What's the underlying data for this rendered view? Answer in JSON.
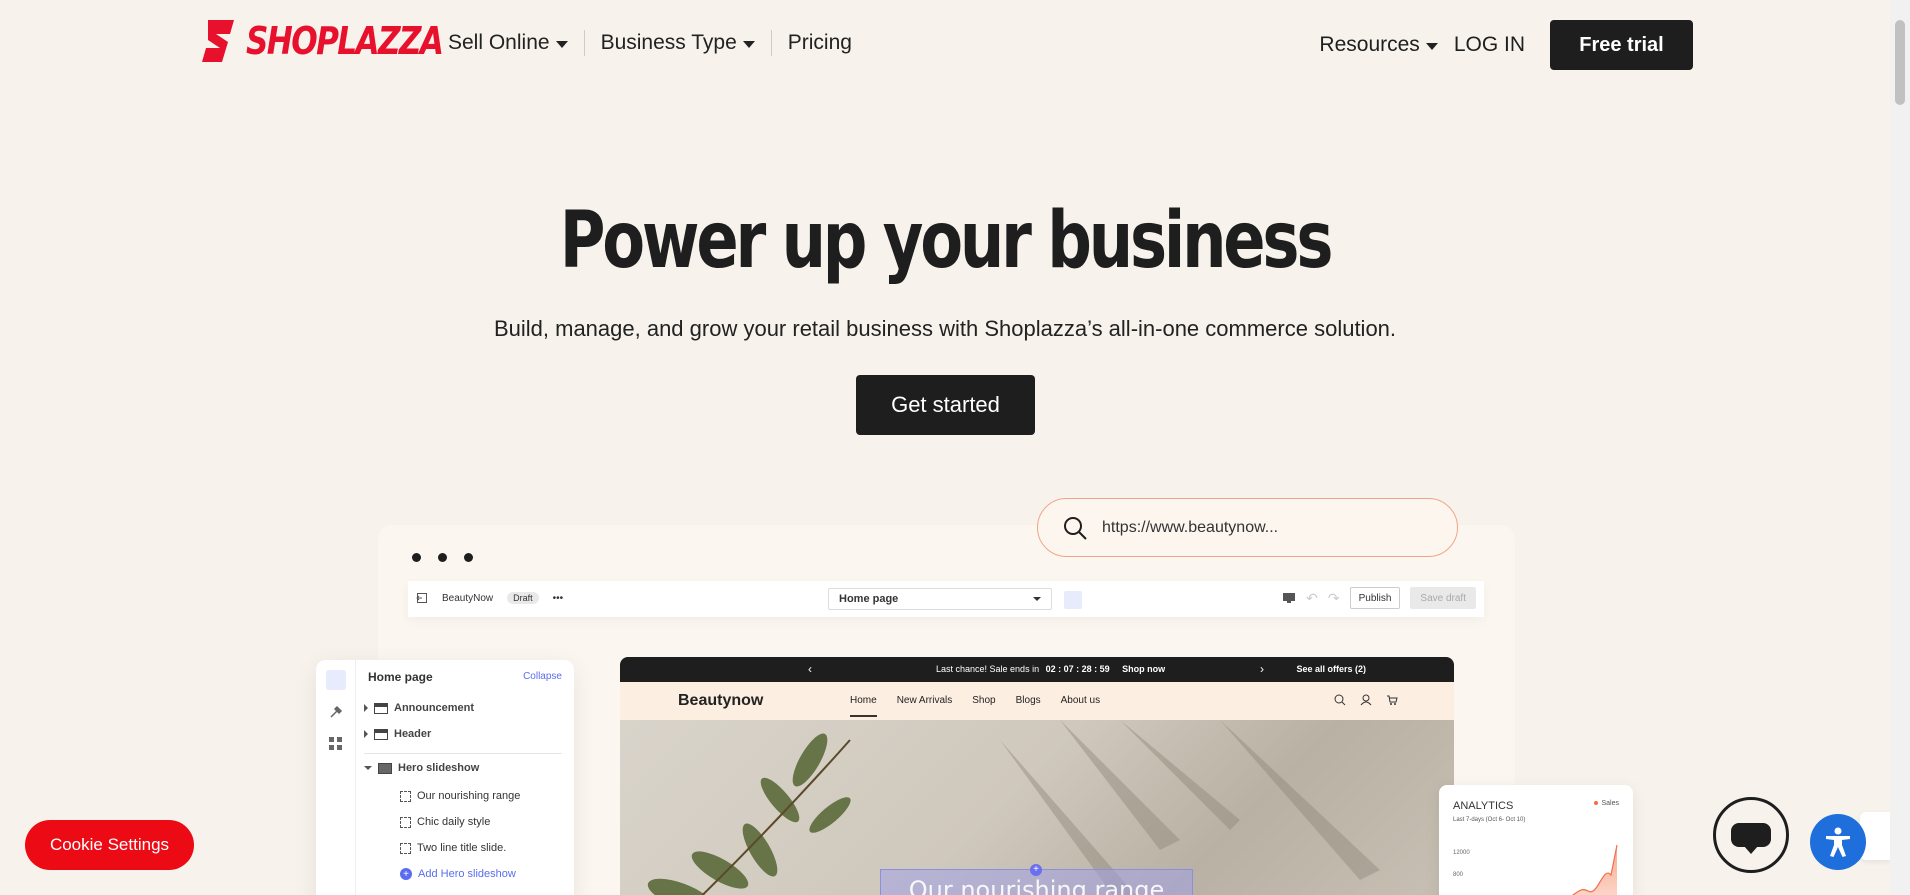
{
  "nav": {
    "logo_text": "SHOPLAZZA",
    "menu": [
      {
        "label": "Sell Online",
        "dropdown": true
      },
      {
        "label": "Business Type",
        "dropdown": true
      },
      {
        "label": "Pricing",
        "dropdown": false
      }
    ],
    "resources": "Resources",
    "login": "LOG IN",
    "trial": "Free trial"
  },
  "hero": {
    "title": "Power up your business",
    "subtitle": "Build, manage, and grow your retail business with Shoplazza’s all-in-one commerce solution.",
    "cta": "Get started"
  },
  "mockup": {
    "search_text": "https://www.beautynow...",
    "editor": {
      "store_name": "BeautyNow",
      "status": "Draft",
      "page_select": "Home page",
      "publish": "Publish",
      "save_draft": "Save draft"
    },
    "panel": {
      "title": "Home page",
      "collapse": "Collapse",
      "sections": [
        "Announcement",
        "Header",
        "Hero slideshow"
      ],
      "slides": [
        "Our nourishing range",
        "Chic daily style",
        "Two line title slide."
      ],
      "add": "Add Hero slideshow"
    },
    "store": {
      "announcement": "Last chance! Sale ends in",
      "timer": "02 : 07 : 28 : 59",
      "shop_now": "Shop now",
      "offers": "See  all offers (2)",
      "brand": "Beautynow",
      "links": [
        "Home",
        "New Arrivals",
        "Shop",
        "Blogs",
        "About us"
      ],
      "overlay": "Our nourishing range"
    },
    "analytics": {
      "title": "ANALYTICS",
      "range": "Last 7-days (Oct 6- Oct 10)",
      "legend": "Sales",
      "yticks": [
        "12000",
        "800"
      ]
    }
  },
  "cookie": "Cookie Settings",
  "colors": {
    "brand_red": "#e8112d",
    "dark": "#1e1e1e",
    "accent_blue": "#1e6fdc",
    "background": "#f7f3ec"
  }
}
